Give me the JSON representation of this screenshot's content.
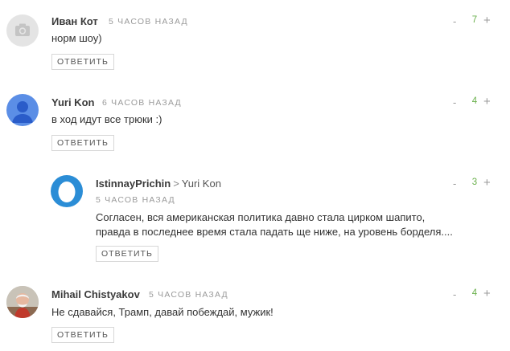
{
  "colors": {
    "vote_count": "#6ab04c",
    "muted": "#9a9a9a",
    "avatar_default_bg": "#e4e4e4",
    "avatar_user_bg": "#5b8ee6",
    "avatar_egg_bg": "#2b8dd6"
  },
  "comments": [
    {
      "author": "Иван Кот",
      "time": "5 ЧАСОВ НАЗАД",
      "text": [
        "норм шоу)"
      ],
      "reply_label": "ОТВЕТИТЬ",
      "minus": "-",
      "votes": "7",
      "plus": "+",
      "avatar_icon": "camera-icon"
    },
    {
      "author": "Yuri Kon",
      "time": "6 ЧАСОВ НАЗАД",
      "text": [
        "в ход идут все трюки :)"
      ],
      "reply_label": "ОТВЕТИТЬ",
      "minus": "-",
      "votes": "4",
      "plus": "+",
      "avatar_icon": "user-silhouette-icon"
    },
    {
      "author": "IstinnayPrichin",
      "reply_arrow": ">",
      "reply_to": "Yuri Kon",
      "time": "5 ЧАСОВ НАЗАД",
      "text": [
        "Согласен, вся американская политика давно стала цирком шапито,",
        "правда в последнее время стала падать ще ниже, на уровень борделя...."
      ],
      "reply_label": "ОТВЕТИТЬ",
      "minus": "-",
      "votes": "3",
      "plus": "+",
      "avatar_icon": "egg-icon"
    },
    {
      "author": "Mihail Chistyakov",
      "time": "5 ЧАСОВ НАЗАД",
      "text": [
        "Не сдавайся, Трамп, давай побеждай, мужик!"
      ],
      "reply_label": "ОТВЕТИТЬ",
      "minus": "-",
      "votes": "4",
      "plus": "+",
      "avatar_icon": "photo-avatar-icon"
    }
  ]
}
